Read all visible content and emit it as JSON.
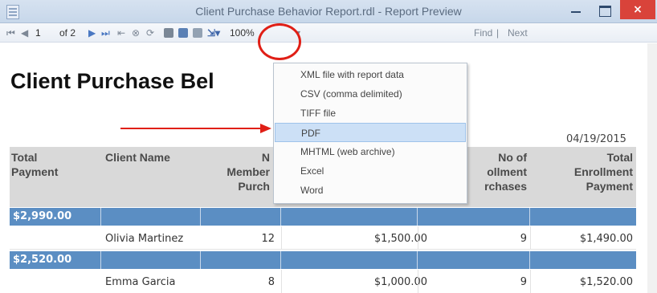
{
  "window": {
    "title": "Client Purchase Behavior Report.rdl - Report Preview",
    "close_glyph": "×"
  },
  "toolbar": {
    "page_current": "1",
    "page_of": "of 2",
    "zoom": "100%",
    "find_label": "Find",
    "next_label": "Next"
  },
  "export_menu": {
    "items": [
      "XML file with report data",
      "CSV (comma delimited)",
      "TIFF file",
      "PDF",
      "MHTML (web archive)",
      "Excel",
      "Word"
    ],
    "highlighted": "PDF"
  },
  "report": {
    "title": "Client Purchase Bel",
    "date": "04/19/2015",
    "columns": [
      {
        "lines": [
          "Total",
          "Payment"
        ]
      },
      {
        "lines": [
          "Client Name"
        ]
      },
      {
        "lines": [
          "N",
          "Member",
          "Purch"
        ]
      },
      {
        "lines": [
          "No of",
          "ollment",
          "rchases"
        ]
      },
      {
        "lines": [
          "Total",
          "Enrollment",
          "Payment"
        ]
      }
    ],
    "groups": [
      {
        "total": "$2,990.00",
        "client": "Olivia Martinez",
        "member_purchases": "12",
        "member_amount": "$1,500.00",
        "enrollment_purchases": "9",
        "enrollment_payment": "$1,490.00"
      },
      {
        "total": "$2,520.00",
        "client": "Emma Garcia",
        "member_purchases": "8",
        "member_amount": "$1,000.00",
        "enrollment_purchases": "9",
        "enrollment_payment": "$1,520.00"
      }
    ]
  },
  "colors": {
    "group_row": "#5b8ec3",
    "header_bg": "#d9d9d9",
    "annotation": "#e01f16",
    "highlight": "#cce0f6"
  }
}
